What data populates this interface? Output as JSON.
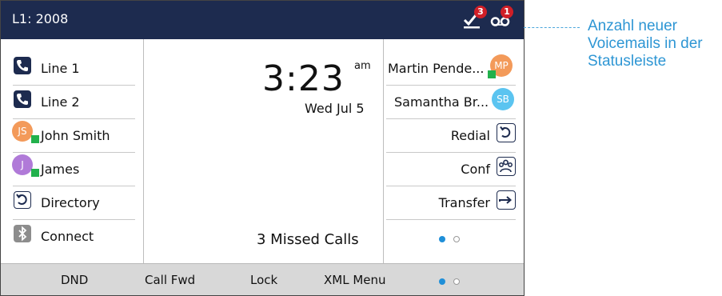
{
  "status_bar": {
    "line_label": "L1: 2008",
    "icons": [
      {
        "name": "missed-calls-check-icon",
        "badge": "3"
      },
      {
        "name": "voicemail-icon",
        "badge": "1"
      }
    ]
  },
  "left_keys": [
    {
      "label": "Line 1",
      "icon": "phone-icon"
    },
    {
      "label": "Line 2",
      "icon": "phone-icon"
    },
    {
      "label": "John Smith",
      "initials": "JS",
      "avatar_color": "#f39a5a",
      "presence": "available"
    },
    {
      "label": "James",
      "initials": "J",
      "avatar_color": "#b07ad8",
      "presence": "available"
    },
    {
      "label": "Directory",
      "icon": "directory-icon"
    },
    {
      "label": "Connect",
      "icon": "bluetooth-icon"
    }
  ],
  "clock": {
    "time": "3:23",
    "ampm": "am",
    "date": "Wed Jul 5"
  },
  "missed_calls": "3  Missed Calls",
  "right_keys": [
    {
      "label": "Martin Pende...",
      "initials": "MP",
      "avatar_color": "#f39a5a",
      "presence": "available"
    },
    {
      "label": "Samantha Br...",
      "initials": "SB",
      "avatar_color": "#5bc4f0"
    },
    {
      "label": "Redial",
      "icon": "redial-icon"
    },
    {
      "label": "Conf",
      "icon": "conference-icon"
    },
    {
      "label": "Transfer",
      "icon": "transfer-icon"
    }
  ],
  "right_pager": {
    "page": 1,
    "pages": 2
  },
  "softkeys": [
    "DND",
    "Call Fwd",
    "Lock",
    "XML Menu"
  ],
  "softkey_pager": {
    "page": 1,
    "pages": 2
  },
  "callout": "Anzahl neuer Voicemails in der Statusleiste",
  "colors": {
    "header": "#1d2b4f",
    "badge": "#d01f27",
    "accent": "#1f8fd8",
    "presence": "#22b14c",
    "callout": "#2e96d4"
  }
}
